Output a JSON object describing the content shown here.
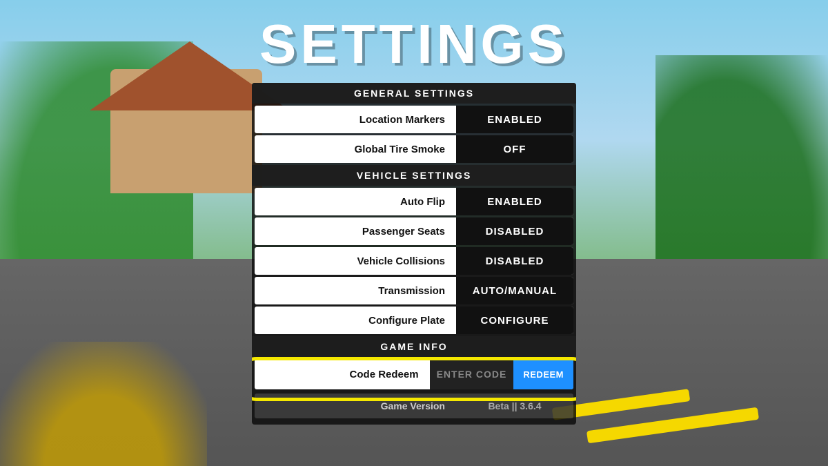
{
  "title": "SETTINGS",
  "sections": {
    "general": {
      "header": "GENERAL SETTINGS",
      "items": [
        {
          "label": "Location Markers",
          "value": "ENABLED",
          "status": "enabled"
        },
        {
          "label": "Global Tire Smoke",
          "value": "OFF",
          "status": "off"
        }
      ]
    },
    "vehicle": {
      "header": "VEHICLE SETTINGS",
      "items": [
        {
          "label": "Auto Flip",
          "value": "ENABLED",
          "status": "enabled"
        },
        {
          "label": "Passenger Seats",
          "value": "DISABLED",
          "status": "disabled"
        },
        {
          "label": "Vehicle Collisions",
          "value": "DISABLED",
          "status": "disabled"
        },
        {
          "label": "Transmission",
          "value": "AUTO/MANUAL",
          "status": "auto"
        },
        {
          "label": "Configure Plate",
          "value": "CONFIGURE",
          "status": "configure"
        }
      ]
    },
    "gameinfo": {
      "header": "GAME INFO"
    },
    "codeRedeem": {
      "label": "Code Redeem",
      "placeholder": "ENTER CODE",
      "button": "REDEEM"
    },
    "gameVersion": {
      "label": "Game Version",
      "value": "Beta || 3.6.4"
    }
  }
}
